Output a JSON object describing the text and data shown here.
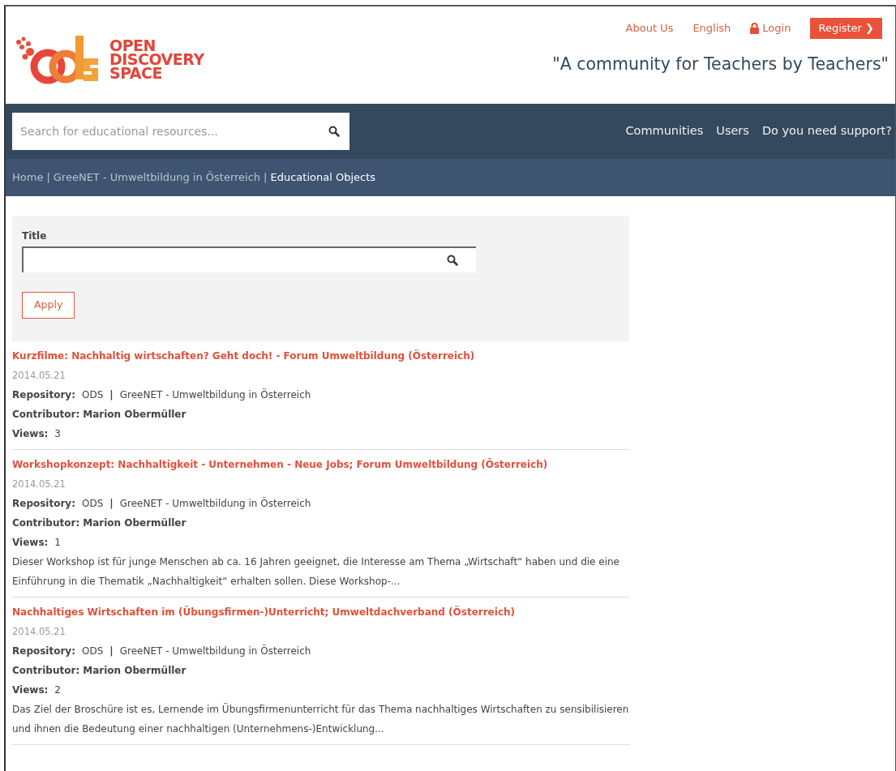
{
  "logo": {
    "lines": [
      "OPEN",
      "DISCOVERY",
      "SPACE"
    ]
  },
  "top_links": [
    {
      "label": "About Us",
      "kind": "link"
    },
    {
      "label": "English",
      "kind": "link"
    },
    {
      "label": "Login",
      "kind": "login"
    },
    {
      "label": "Register",
      "kind": "button",
      "arrow": "❯"
    }
  ],
  "tagline": "\"A community for Teachers by Teachers\"",
  "search": {
    "placeholder": "Search for educational resources..."
  },
  "nav": [
    "Communities",
    "Users",
    "Do you need support?"
  ],
  "breadcrumb_separator": "|",
  "breadcrumb": [
    {
      "label": "Home",
      "selected": false
    },
    {
      "label": "GreeNET - Umweltbildung in Österreich",
      "selected": false
    },
    {
      "label": "Educational Objects",
      "selected": true
    }
  ],
  "filter": {
    "label": "Title",
    "button": "Apply"
  },
  "results": [
    {
      "title": "Kurzfilme: Nachhaltig wirtschaften? Geht doch! - Forum Umweltbildung (Österreich)",
      "date": "2014.05.21",
      "repository_label": "Repository:",
      "repository": "ODS",
      "separator": "|",
      "community": "GreeNET - Umweltbildung in Österreich",
      "contributor_label": "Contributor:",
      "contributor": "Marion Obermüller",
      "views_label": "Views:",
      "views": "3"
    },
    {
      "title": "Workshopkonzept: Nachhaltigkeit - Unternehmen - Neue Jobs; Forum Umweltbildung (Österreich)",
      "date": "2014.05.21",
      "repository_label": "Repository:",
      "repository": "ODS",
      "separator": "|",
      "community": "GreeNET - Umweltbildung in Österreich",
      "contributor_label": "Contributor:",
      "contributor": "Marion Obermüller",
      "views_label": "Views:",
      "views": "1",
      "description": "Dieser Workshop ist für junge Menschen ab ca. 16 Jahren geeignet, die Interesse am Thema „Wirtschaft“ haben und die eine Einführung in die Thematik „Nachhaltigkeit“ erhalten sollen. Diese Workshop-..."
    },
    {
      "title": "Nachhaltiges Wirtschaften im (Übungsfirmen-)Unterricht; Umweltdachverband (Österreich)",
      "date": "2014.05.21",
      "repository_label": "Repository:",
      "repository": "ODS",
      "separator": "|",
      "community": "GreeNET - Umweltbildung in Österreich",
      "contributor_label": "Contributor:",
      "contributor": "Marion Obermüller",
      "views_label": "Views:",
      "views": "2",
      "description": "Das Ziel der Broschüre ist es, Lernende im Übungsfirmenunterricht für das Thema nachhaltiges Wirtschaften zu sensibilisieren und ihnen die Bedeutung einer nachhaltigen (Unternehmens-)Entwicklung..."
    }
  ]
}
